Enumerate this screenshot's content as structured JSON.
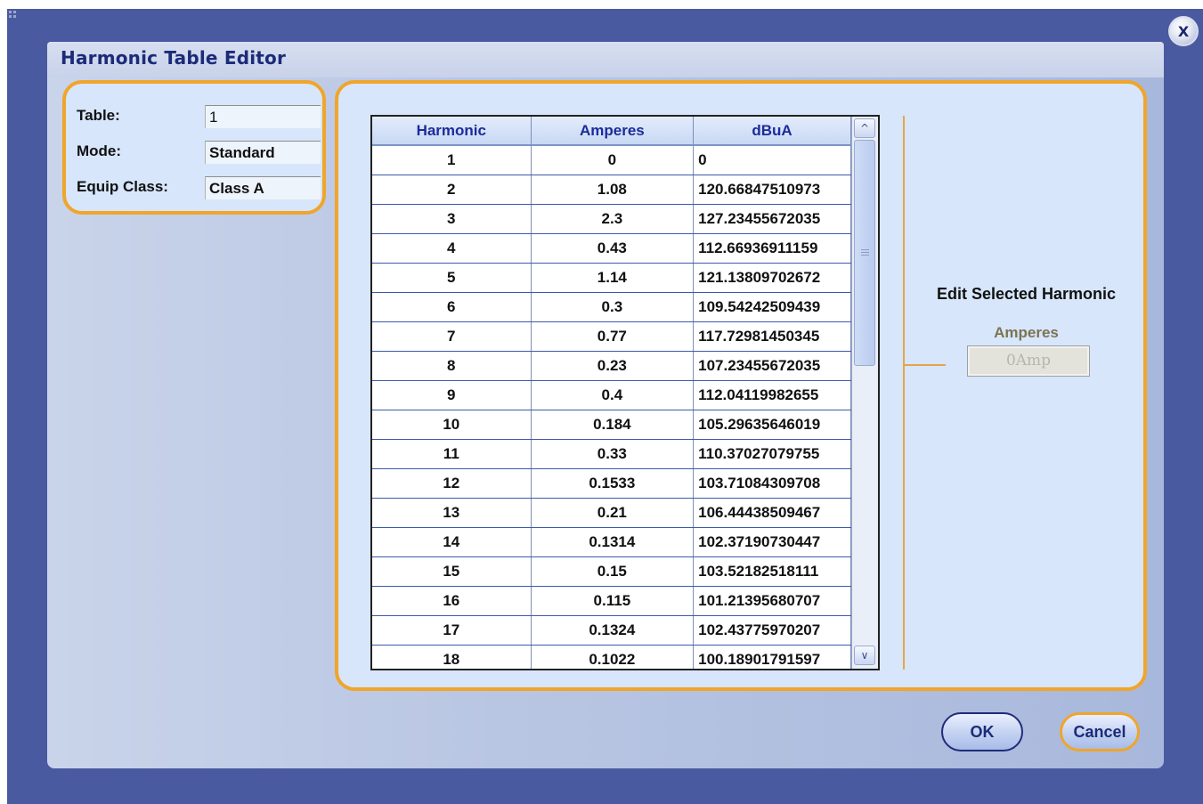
{
  "dialog": {
    "title": "Harmonic Table Editor",
    "close_label": "X",
    "ok_label": "OK",
    "cancel_label": "Cancel"
  },
  "info": {
    "table_label": "Table:",
    "table_value": "1",
    "mode_label": "Mode:",
    "mode_value": "Standard",
    "equip_label": "Equip Class:",
    "equip_value": "Class A"
  },
  "table": {
    "headers": [
      "Harmonic",
      "Amperes",
      "dBuA"
    ],
    "rows": [
      [
        "1",
        "0",
        "0"
      ],
      [
        "2",
        "1.08",
        "120.66847510973"
      ],
      [
        "3",
        "2.3",
        "127.23455672035"
      ],
      [
        "4",
        "0.43",
        "112.66936911159"
      ],
      [
        "5",
        "1.14",
        "121.13809702672"
      ],
      [
        "6",
        "0.3",
        "109.54242509439"
      ],
      [
        "7",
        "0.77",
        "117.72981450345"
      ],
      [
        "8",
        "0.23",
        "107.23455672035"
      ],
      [
        "9",
        "0.4",
        "112.04119982655"
      ],
      [
        "10",
        "0.184",
        "105.29635646019"
      ],
      [
        "11",
        "0.33",
        "110.37027079755"
      ],
      [
        "12",
        "0.1533",
        "103.71084309708"
      ],
      [
        "13",
        "0.21",
        "106.44438509467"
      ],
      [
        "14",
        "0.1314",
        "102.37190730447"
      ],
      [
        "15",
        "0.15",
        "103.52182518111"
      ],
      [
        "16",
        "0.115",
        "101.21395680707"
      ],
      [
        "17",
        "0.1324",
        "102.43775970207"
      ],
      [
        "18",
        "0.1022",
        "100.18901791597"
      ]
    ]
  },
  "editor": {
    "title": "Edit Selected Harmonic",
    "amperes_label": "Amperes",
    "amperes_value": "0Amp"
  },
  "colors": {
    "accent_orange": "#f0a52b",
    "title_blue": "#1c2b78",
    "panel_fill": "#d7e6fb",
    "background": "#4a5aa0"
  }
}
